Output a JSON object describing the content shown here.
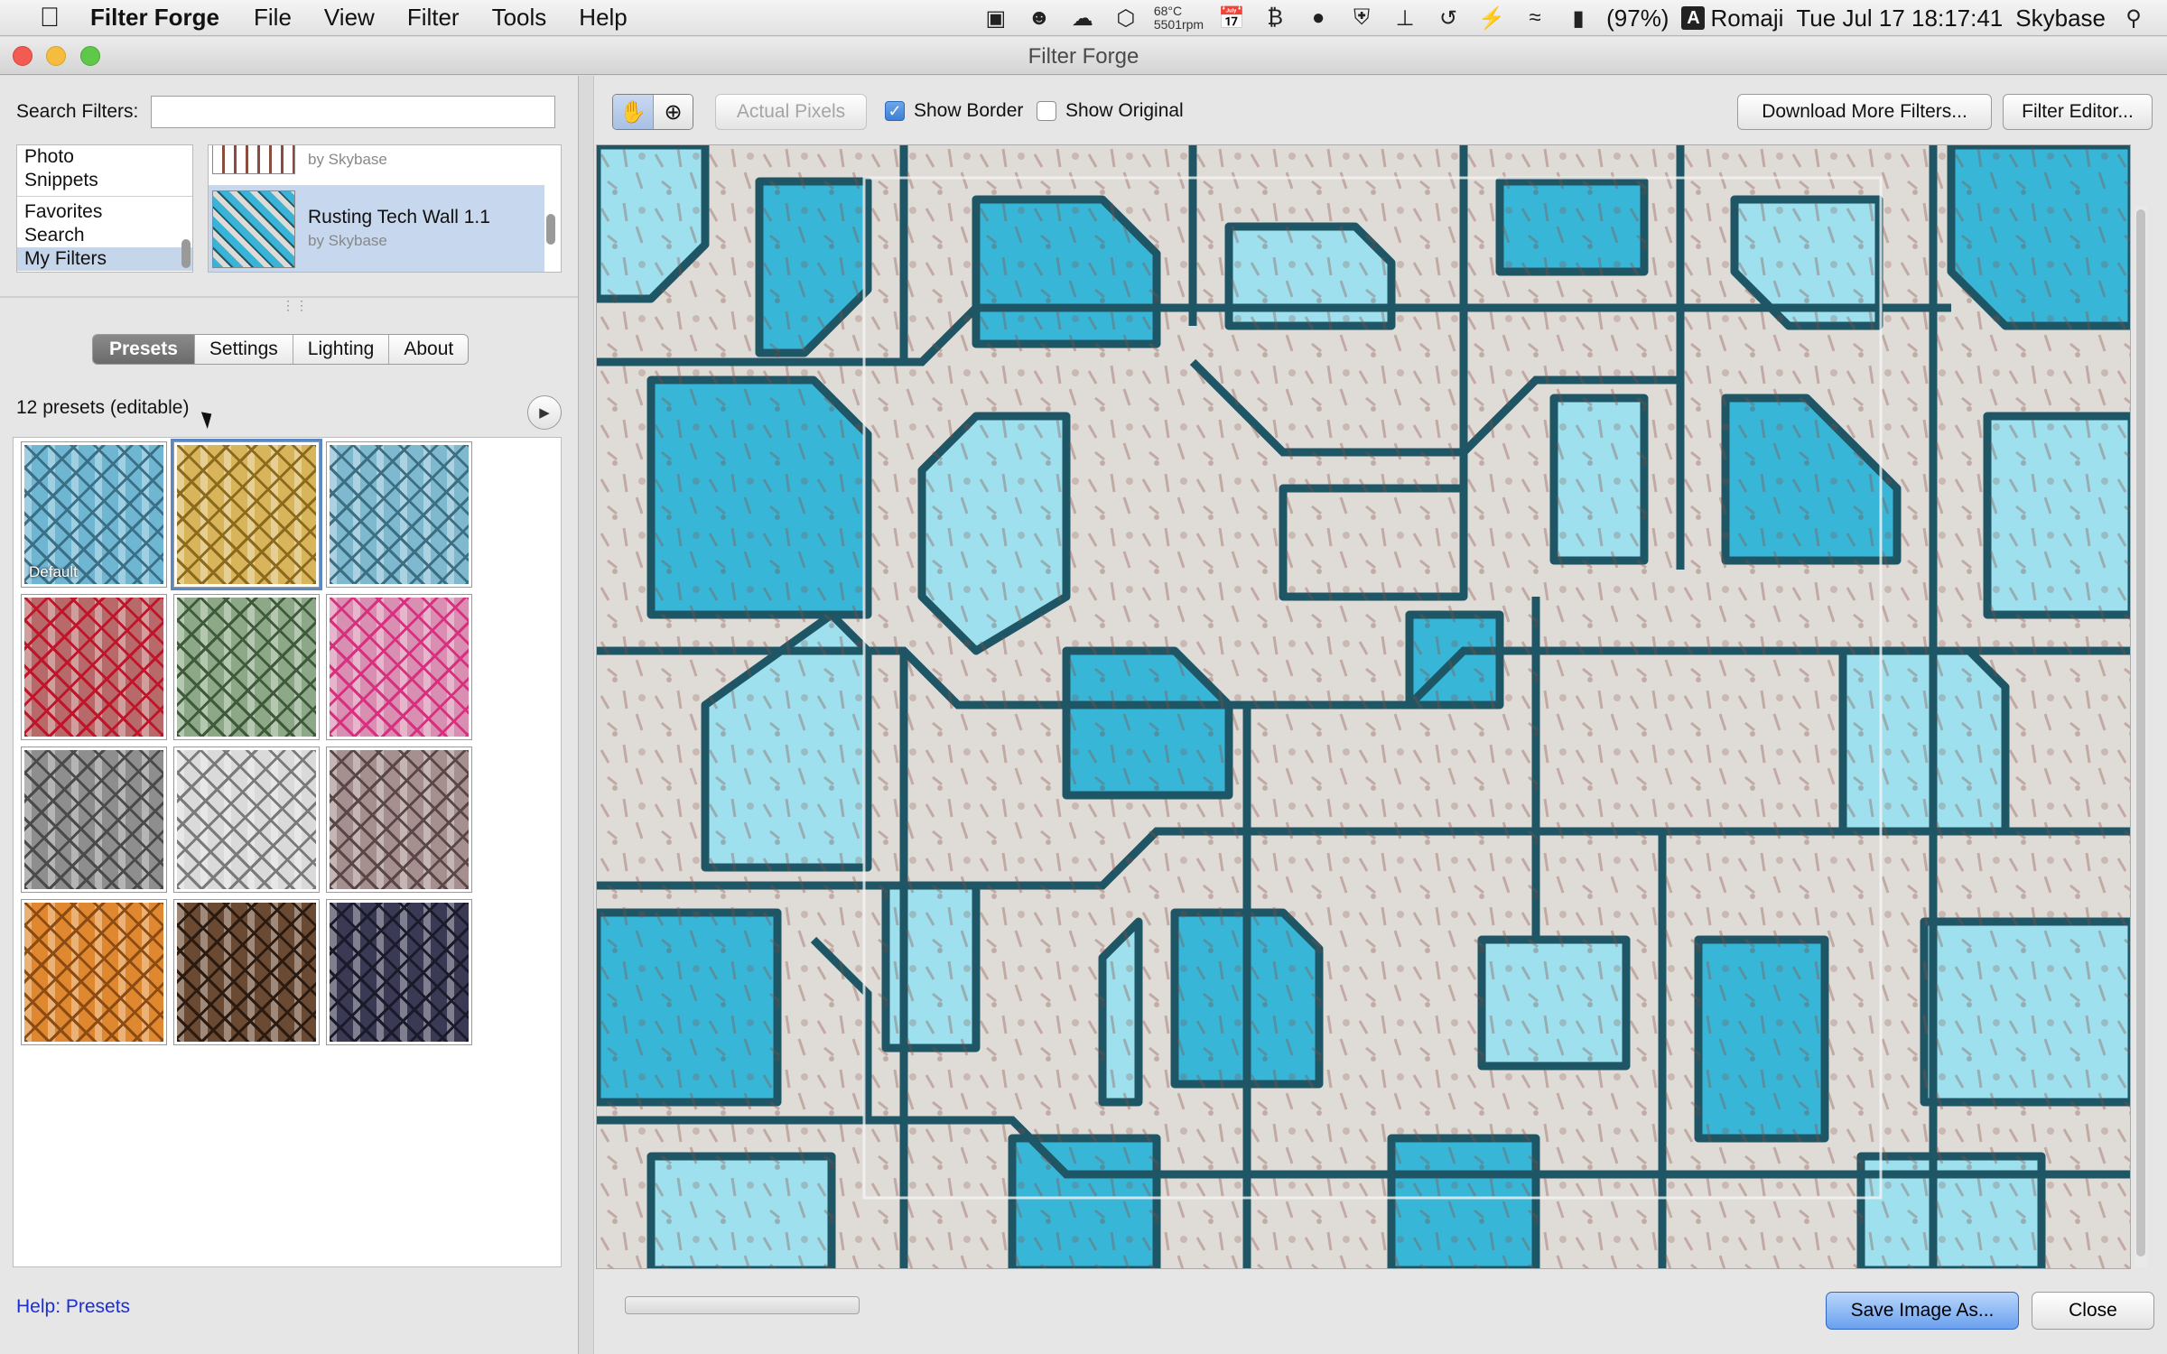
{
  "menubar": {
    "app_name": "Filter Forge",
    "menus": [
      "File",
      "View",
      "Filter",
      "Tools",
      "Help"
    ],
    "temperature": "68°C",
    "fan": "5501rpm",
    "battery": "(97%)",
    "input_source": "Romaji",
    "input_source_letter": "A",
    "datetime": "Tue Jul 17  18:17:41",
    "user": "Skybase"
  },
  "window": {
    "title": "Filter Forge"
  },
  "left": {
    "search_label": "Search Filters:",
    "search_value": "",
    "categories": [
      {
        "label": "Photo",
        "selected": false
      },
      {
        "label": "Snippets",
        "selected": false
      },
      {
        "label": "Favorites",
        "selected": false
      },
      {
        "label": "Search",
        "selected": false
      },
      {
        "label": "My Filters",
        "selected": true
      }
    ],
    "filters": [
      {
        "name": "",
        "author": "by Skybase",
        "selected": false
      },
      {
        "name": "Rusting Tech Wall 1.1",
        "author": "by Skybase",
        "selected": true
      }
    ],
    "tabs": [
      {
        "label": "Presets",
        "active": true
      },
      {
        "label": "Settings",
        "active": false
      },
      {
        "label": "Lighting",
        "active": false
      },
      {
        "label": "About",
        "active": false
      }
    ],
    "presets_count": "12 presets (editable)",
    "presets": [
      {
        "label": "Default",
        "color": "#6fb6d2",
        "accent": "#3a6f86",
        "selected": false
      },
      {
        "label": "",
        "color": "#d8b55a",
        "accent": "#8b6a1e",
        "selected": true
      },
      {
        "label": "",
        "color": "#7fb9cf",
        "accent": "#3d6f83",
        "selected": false
      },
      {
        "label": "",
        "color": "#b86a6a",
        "accent": "#c0142a",
        "selected": false
      },
      {
        "label": "",
        "color": "#8da887",
        "accent": "#3e5a3a",
        "selected": false
      },
      {
        "label": "",
        "color": "#d88fb2",
        "accent": "#d8307f",
        "selected": false
      },
      {
        "label": "",
        "color": "#8e8e8e",
        "accent": "#4a4a4a",
        "selected": false
      },
      {
        "label": "",
        "color": "#dadada",
        "accent": "#7a7a7a",
        "selected": false
      },
      {
        "label": "",
        "color": "#a68f8f",
        "accent": "#5a4646",
        "selected": false
      },
      {
        "label": "",
        "color": "#e0882f",
        "accent": "#8b4b12",
        "selected": false
      },
      {
        "label": "",
        "color": "#6a4a33",
        "accent": "#2a1a10",
        "selected": false
      },
      {
        "label": "",
        "color": "#3b3a55",
        "accent": "#1a1a2a",
        "selected": false
      }
    ],
    "help_link": "Help: Presets"
  },
  "toolbar": {
    "actual_pixels": "Actual Pixels",
    "show_border": "Show Border",
    "show_border_checked": true,
    "show_original": "Show Original",
    "show_original_checked": false,
    "download_more": "Download More Filters...",
    "filter_editor": "Filter Editor..."
  },
  "colors": {
    "tile_blue": "#38b6d8",
    "tile_light": "#9ee0ee",
    "tile_stone": "#dfdcd8",
    "groove": "#1f5666",
    "rust": "#8a4c3f"
  },
  "footer": {
    "save_label": "Save Image As...",
    "close_label": "Close"
  }
}
